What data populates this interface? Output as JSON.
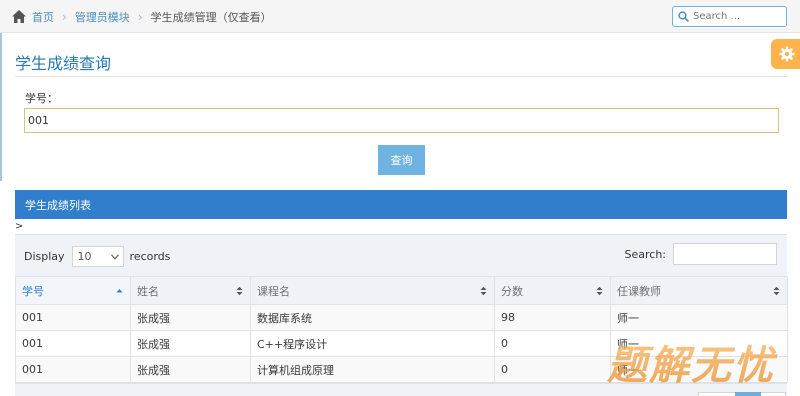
{
  "breadcrumb": {
    "home": "首页",
    "module": "管理员模块",
    "current": "学生成绩管理（仅查看）"
  },
  "nav_search": {
    "placeholder": "Search ..."
  },
  "page": {
    "title": "学生成绩查询"
  },
  "form": {
    "id_label": "学号：",
    "id_value": "001",
    "query_button": "查询"
  },
  "panel": {
    "title": "学生成绩列表",
    "marker": ">"
  },
  "datatable": {
    "display_label": "Display",
    "page_length": "10",
    "records_label": "records",
    "search_label": "Search:",
    "columns": [
      "学号",
      "姓名",
      "课程名",
      "分数",
      "任课教师"
    ],
    "rows": [
      [
        "001",
        "张成强",
        "数据库系统",
        "98",
        "师一"
      ],
      [
        "001",
        "张成强",
        "C++程序设计",
        "0",
        "师一"
      ],
      [
        "001",
        "张成强",
        "计算机组成原理",
        "0",
        "师一"
      ]
    ]
  },
  "watermark": {
    "text": "题解无忧"
  },
  "colors": {
    "accent": "#307ecc",
    "link": "#4c8fbd",
    "button": "#6fb3e0",
    "settings": "#ffb44b",
    "watermark": "#f0a24a"
  }
}
